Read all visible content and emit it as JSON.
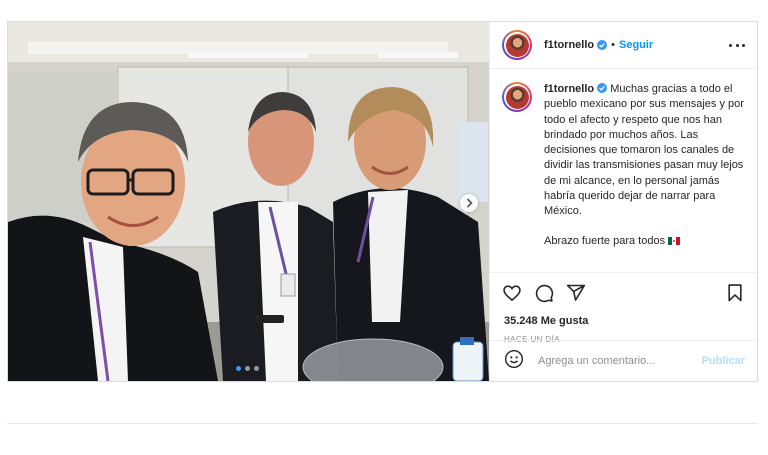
{
  "post": {
    "username": "f1tornello",
    "verified": true,
    "separator": "•",
    "follow_label": "Seguir",
    "caption_text": "Muchas gracias a todo el pueblo mexicano por sus mensajes y por todo el afecto y respeto que nos han brindado por muchos años. Las decisiones que tomaron los canales de dividir las transmisiones pasan muy lejos de mi alcance, en lo personal jamás habría querido dejar de narrar para México.",
    "caption_greeting": "Abrazo fuerte para todos",
    "likes": "35.248 Me gusta",
    "time_ago": "HACE UN DÍA",
    "carousel": {
      "count": 3,
      "active": 1
    }
  },
  "comment": {
    "placeholder": "Agrega un comentario...",
    "publish_label": "Publicar"
  },
  "icons": {
    "like": "heart-icon",
    "comment": "comment-icon",
    "share": "share-icon",
    "save": "bookmark-icon",
    "emoji": "emoji-icon",
    "more": "more-options-icon",
    "next": "chevron-right-icon",
    "verified": "verified-badge-icon",
    "flag": "mexico-flag-icon"
  },
  "colors": {
    "accent": "#0095f6",
    "publish_disabled": "#b2dffc",
    "muted": "#8e8e8e",
    "border": "#dbdbdb"
  }
}
